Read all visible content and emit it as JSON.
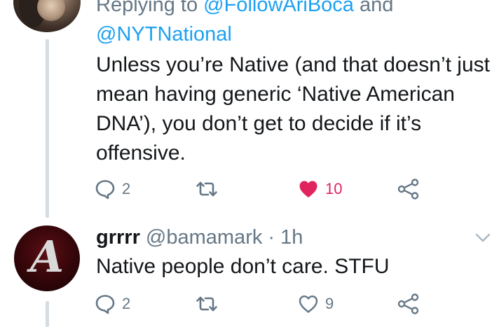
{
  "tweet1": {
    "reply_prefix": "Replying to ",
    "mention1": "@FollowAriBoca",
    "reply_and": " and",
    "mention2": "@NYTNational",
    "text": "Unless you’re Native (and that doesn’t just mean having generic ‘Native American DNA’), you don’t get to decide if it’s offensive.",
    "reply_count": "2",
    "like_count": "10",
    "liked": true
  },
  "tweet2": {
    "display_name": "grrrr",
    "handle": "@bamamark",
    "separator": " · ",
    "time": "1h",
    "avatar_letter": "A",
    "text": "Native people don’t care.  STFU",
    "reply_count": "2",
    "like_count": "9",
    "liked": false
  },
  "colors": {
    "accent": "#1da1f2",
    "like": "#e0245e",
    "muted": "#657786",
    "text": "#14171a",
    "thread_line": "#d5dde3"
  },
  "icons": {
    "reply": "speech-bubble-icon",
    "retweet": "retweet-icon",
    "like": "heart-icon",
    "share": "share-icon",
    "more": "chevron-down-icon"
  }
}
